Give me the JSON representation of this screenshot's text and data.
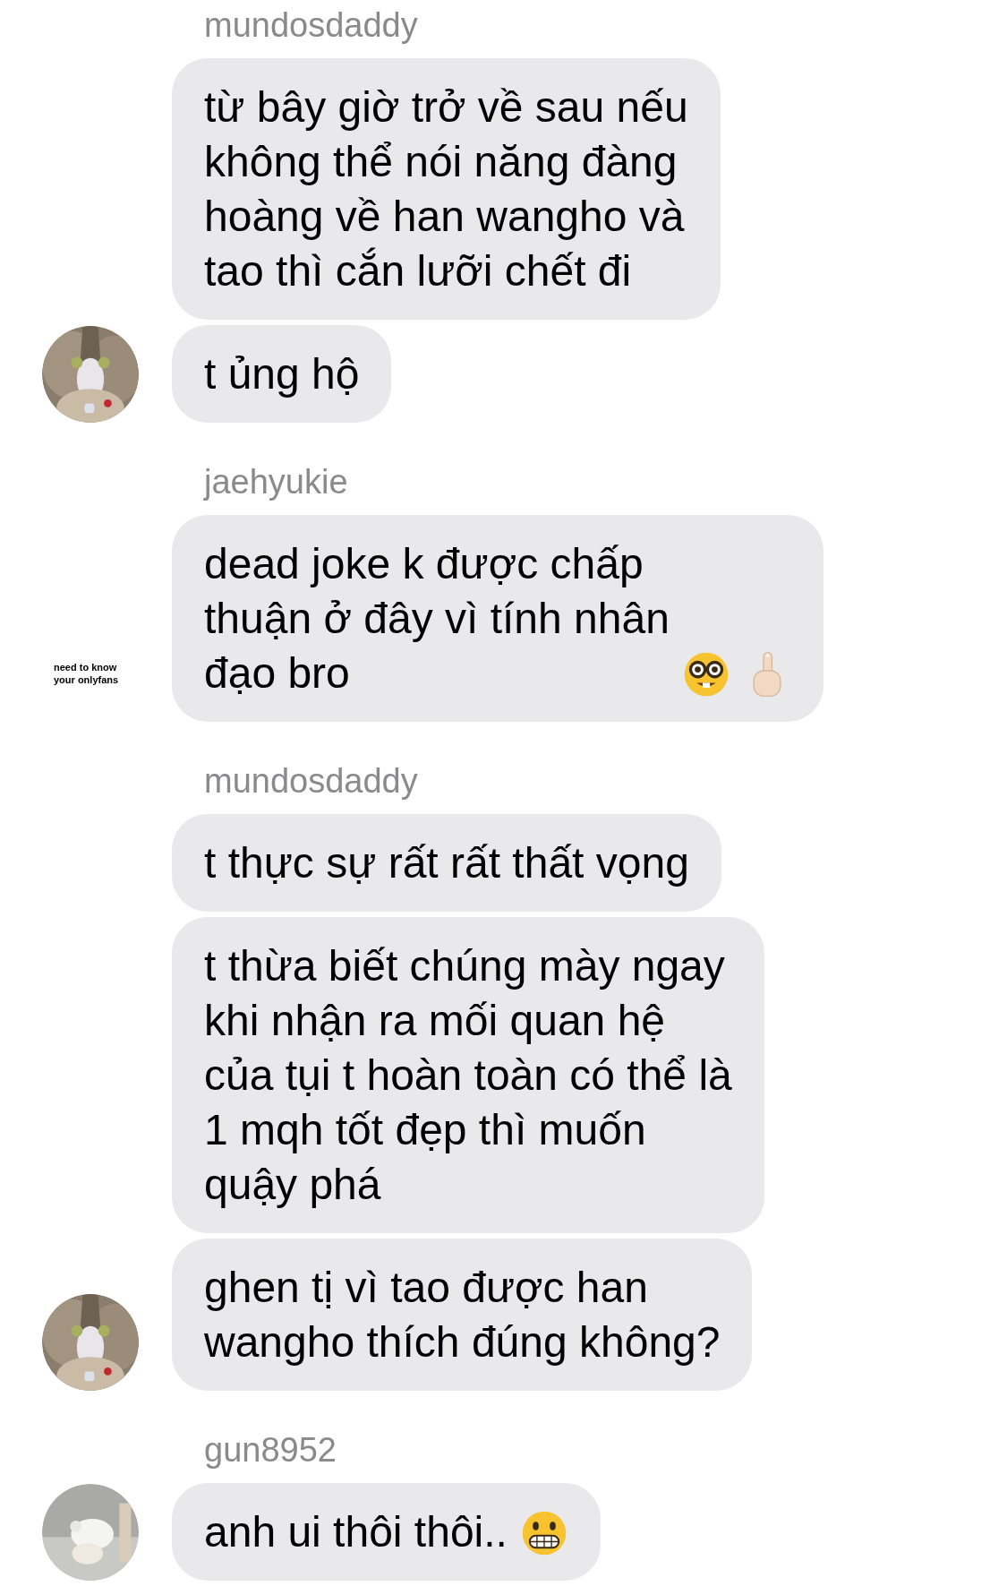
{
  "groups": [
    {
      "sender": "mundosdaddy",
      "avatar": {
        "kind": "cat"
      },
      "messages": [
        {
          "text": "từ bây giờ trở về sau nếu\nkhông thể nói năng đàng\nhoàng về han wangho và\ntao thì cắn lưỡi chết đi"
        },
        {
          "text": "t ủng hộ"
        }
      ]
    },
    {
      "sender": "jaehyukie",
      "avatar": {
        "kind": "text",
        "text": "need to know your onlyfans"
      },
      "messages": [
        {
          "text": "dead joke k được chấp\nthuận ở đây vì tính nhân\nđạo bro",
          "emojis": [
            {
              "kind": "nerd"
            },
            {
              "kind": "point-up"
            }
          ]
        }
      ]
    },
    {
      "sender": "mundosdaddy",
      "avatar": {
        "kind": "cat"
      },
      "messages": [
        {
          "text": "t thực sự rất rất thất vọng"
        },
        {
          "text": "t thừa biết chúng mày ngay\nkhi nhận ra mối quan hệ\ncủa tụi t hoàn toàn có thể là\n1 mqh tốt đẹp thì muốn\nquậy phá"
        },
        {
          "text": "ghen tị vì tao được han\nwangho thích đúng không?"
        }
      ]
    },
    {
      "sender": "gun8952",
      "avatar": {
        "kind": "dog"
      },
      "messages": [
        {
          "text": "anh ui thôi thôi..",
          "emojis": [
            {
              "kind": "grimace"
            }
          ]
        }
      ]
    }
  ]
}
